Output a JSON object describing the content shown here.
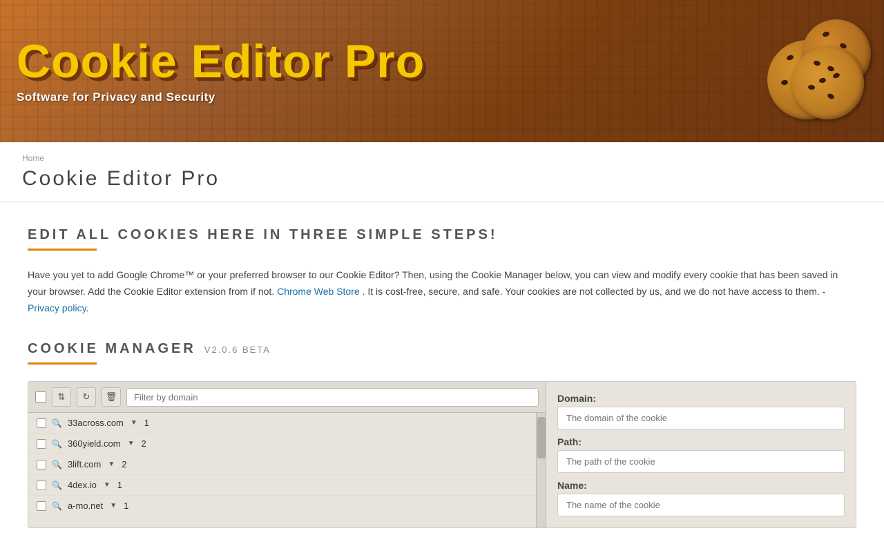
{
  "header": {
    "title": "Cookie Editor Pro",
    "subtitle": "Software for Privacy and Security",
    "cookie_alt": "Cookie image"
  },
  "breadcrumb": {
    "text": "Home"
  },
  "page_header": {
    "title": "Cookie Editor Pro"
  },
  "section1": {
    "title": "EDIT ALL COOKIES HERE IN THREE SIMPLE STEPS!",
    "intro_text_before_link": "Have you yet to add Google Chrome™ or your preferred browser to our Cookie Editor? Then, using the Cookie Manager below, you can view and modify every cookie that has been saved in your browser. Add the Cookie Editor extension from if not.",
    "chrome_link": "Chrome Web Store",
    "intro_text_after_link": ". It is cost-free, secure, and safe. Your cookies are not collected by us, and we do not have access to them. -",
    "privacy_link": "Privacy policy",
    "privacy_link_suffix": "."
  },
  "section2": {
    "title": "COOKIE MANAGER",
    "version": "V2.0.6 BETA"
  },
  "toolbar": {
    "filter_placeholder": "Filter by domain",
    "refresh_icon": "↻",
    "delete_icon": "🗑",
    "sort_icon": "⇅"
  },
  "cookie_list": {
    "items": [
      {
        "domain": "33across.com",
        "count": "1"
      },
      {
        "domain": "360yield.com",
        "count": "2"
      },
      {
        "domain": "3lift.com",
        "count": "2"
      },
      {
        "domain": "4dex.io",
        "count": "1"
      },
      {
        "domain": "a-mo.net",
        "count": "1"
      }
    ]
  },
  "right_panel": {
    "domain_label": "Domain:",
    "domain_placeholder": "The domain of the cookie",
    "path_label": "Path:",
    "path_placeholder": "The path of the cookie",
    "name_label": "Name:",
    "name_placeholder": "The name of the cookie"
  }
}
